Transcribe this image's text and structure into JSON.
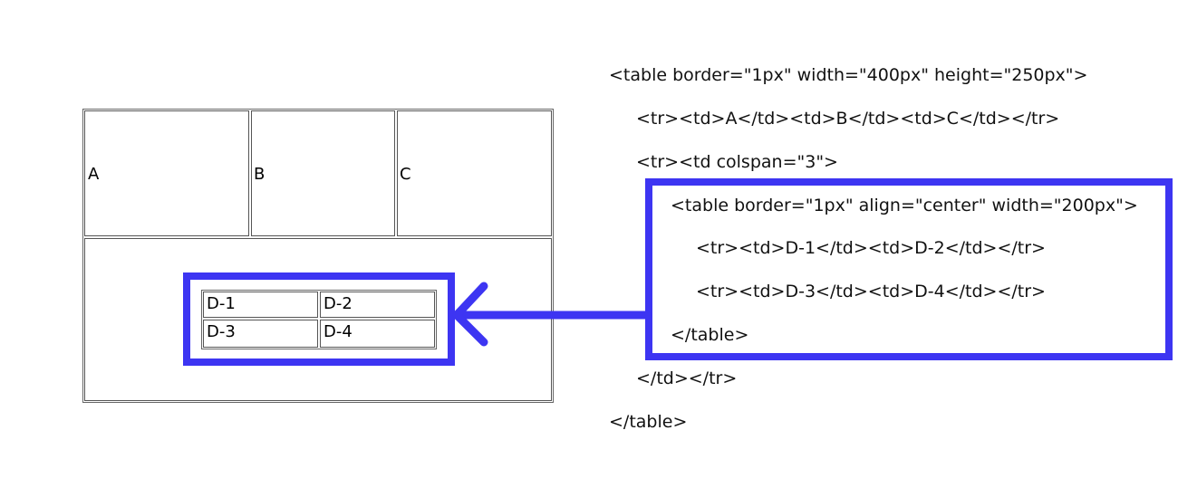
{
  "rendered_table": {
    "row1": [
      "A",
      "B",
      "C"
    ],
    "inner": [
      [
        "D-1",
        "D-2"
      ],
      [
        "D-3",
        "D-4"
      ]
    ]
  },
  "code": {
    "lines": [
      "<table border=\"1px\" width=\"400px\" height=\"250px\">",
      "<tr><td>A</td><td>B</td><td>C</td></tr>",
      "<tr><td colspan=\"3\">",
      "<table border=\"1px\" align=\"center\" width=\"200px\">",
      "<tr><td>D-1</td><td>D-2</td></tr>",
      "<tr><td>D-3</td><td>D-4</td></tr>",
      "</table>",
      "</td></tr>",
      "</table>"
    ]
  },
  "colors": {
    "highlight": "#3d35f2",
    "border": "#555555"
  },
  "icons": {
    "connector": "arrow-left-icon"
  }
}
